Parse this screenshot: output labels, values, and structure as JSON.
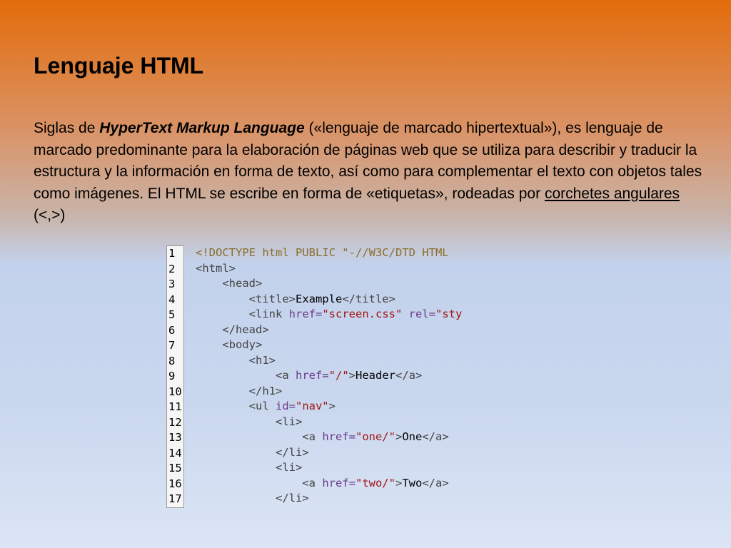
{
  "slide": {
    "title": "Lenguaje HTML",
    "paragraph": {
      "p1": "Siglas de ",
      "emphasis": "HyperText Markup Language",
      "p2": " («lenguaje de marcado hipertextual»), es lenguaje de marcado predominante para la elaboración de páginas web que se utiliza para describir y traducir la estructura y la información en forma de texto, así como para complementar el texto con objetos tales como imágenes. El HTML se escribe en forma de «etiquetas», rodeadas por ",
      "link": "corchetes angulares",
      "p3": " (<,>)"
    }
  },
  "code_sample": {
    "line_numbers": [
      "1",
      "2",
      "3",
      "4",
      "5",
      "6",
      "7",
      "8",
      "9",
      "10",
      "11",
      "12",
      "13",
      "14",
      "15",
      "16",
      "17"
    ],
    "lines": [
      [
        {
          "t": "<!DOCTYPE html PUBLIC \"-//W3C/DTD HTML",
          "c": "doctype"
        }
      ],
      [
        {
          "t": "<html>",
          "c": "tag"
        }
      ],
      [
        {
          "t": "    <head>",
          "c": "tag"
        }
      ],
      [
        {
          "t": "        <title>",
          "c": "tag"
        },
        {
          "t": "Example",
          "c": "txt"
        },
        {
          "t": "</title>",
          "c": "tag"
        }
      ],
      [
        {
          "t": "        <link ",
          "c": "tag"
        },
        {
          "t": "href=",
          "c": "attr"
        },
        {
          "t": "\"screen.css\"",
          "c": "str"
        },
        {
          "t": " rel=",
          "c": "attr"
        },
        {
          "t": "\"sty",
          "c": "str"
        }
      ],
      [
        {
          "t": "    </head>",
          "c": "tag"
        }
      ],
      [
        {
          "t": "    <body>",
          "c": "tag"
        }
      ],
      [
        {
          "t": "        <h1>",
          "c": "tag"
        }
      ],
      [
        {
          "t": "            <a ",
          "c": "tag"
        },
        {
          "t": "href=",
          "c": "attr"
        },
        {
          "t": "\"/\"",
          "c": "str"
        },
        {
          "t": ">",
          "c": "tag"
        },
        {
          "t": "Header",
          "c": "txt"
        },
        {
          "t": "</a>",
          "c": "tag"
        }
      ],
      [
        {
          "t": "        </h1>",
          "c": "tag"
        }
      ],
      [
        {
          "t": "        <ul ",
          "c": "tag"
        },
        {
          "t": "id=",
          "c": "attr"
        },
        {
          "t": "\"nav\"",
          "c": "str"
        },
        {
          "t": ">",
          "c": "tag"
        }
      ],
      [
        {
          "t": "            <li>",
          "c": "tag"
        }
      ],
      [
        {
          "t": "                <a ",
          "c": "tag"
        },
        {
          "t": "href=",
          "c": "attr"
        },
        {
          "t": "\"one/\"",
          "c": "str"
        },
        {
          "t": ">",
          "c": "tag"
        },
        {
          "t": "One",
          "c": "txt"
        },
        {
          "t": "</a>",
          "c": "tag"
        }
      ],
      [
        {
          "t": "            </li>",
          "c": "tag"
        }
      ],
      [
        {
          "t": "            <li>",
          "c": "tag"
        }
      ],
      [
        {
          "t": "                <a ",
          "c": "tag"
        },
        {
          "t": "href=",
          "c": "attr"
        },
        {
          "t": "\"two/\"",
          "c": "str"
        },
        {
          "t": ">",
          "c": "tag"
        },
        {
          "t": "Two",
          "c": "txt"
        },
        {
          "t": "</a>",
          "c": "tag"
        }
      ],
      [
        {
          "t": "            </li>",
          "c": "tag"
        }
      ]
    ]
  }
}
